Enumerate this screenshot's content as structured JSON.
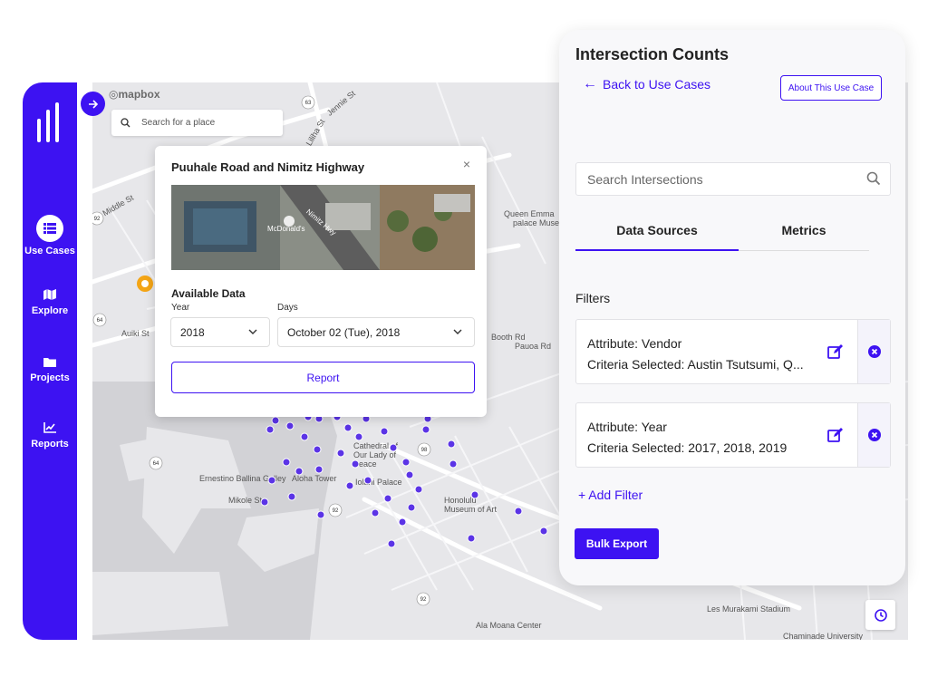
{
  "sidebar": {
    "items": [
      {
        "label": "Use Cases",
        "icon": "list-icon"
      },
      {
        "label": "Explore",
        "icon": "map-icon"
      },
      {
        "label": "Projects",
        "icon": "folder-icon"
      },
      {
        "label": "Reports",
        "icon": "chart-line-icon"
      }
    ]
  },
  "map": {
    "brand": "mapbox",
    "search_placeholder": "Search for a place",
    "labels": {
      "ernestino": "Ernestino Ballina Galley",
      "aloha_tower": "Aloha Tower",
      "iolani": "Iolani Palace",
      "cathedral": "Cathedral of Our Lady of Peace",
      "honolulu_museum": "Honolulu Museum of Art",
      "queen_emma": "Queen Emma",
      "palace_museum": "palace Muse",
      "mikole": "Mikole St",
      "auiki": "Auiki St",
      "booth": "Booth Rd",
      "pauoa": "Pauoa Rd",
      "ala_moana": "Ala Moana Center",
      "les_murakami": "Les Murakami Stadium",
      "chaminade": "Chaminade University",
      "middle": "Middle St",
      "kaahumanu": "Kaahumanu St",
      "jennie": "Jennie St",
      "liliha": "Liliha St",
      "mcdonalds": "McDonald's",
      "nimitz_hwy": "Nimitz Hwy"
    }
  },
  "popup": {
    "title": "Puuhale Road and Nimitz Highway",
    "close": "×",
    "available_data": "Available Data",
    "year_label": "Year",
    "days_label": "Days",
    "year_value": "2018",
    "days_value": "October 02 (Tue), 2018",
    "report_button": "Report"
  },
  "panel": {
    "title": "Intersection Counts",
    "back_label": "Back to Use Cases",
    "about_button": "About This Use Case",
    "search_placeholder": "Search Intersections",
    "tabs": [
      {
        "label": "Data Sources",
        "active": true
      },
      {
        "label": "Metrics",
        "active": false
      }
    ],
    "filters_heading": "Filters",
    "filters": [
      {
        "attribute": "Attribute: Vendor",
        "criteria": "Criteria Selected: Austin Tsutsumi, Q..."
      },
      {
        "attribute": "Attribute: Year",
        "criteria": "Criteria Selected: 2017, 2018, 2019"
      }
    ],
    "add_filter": "+ Add Filter",
    "bulk_export": "Bulk Export"
  },
  "colors": {
    "accent": "#3d12f2",
    "marker": "#5b34e6",
    "map_bg": "#e7e7ea",
    "water": "#d2d2d6"
  }
}
